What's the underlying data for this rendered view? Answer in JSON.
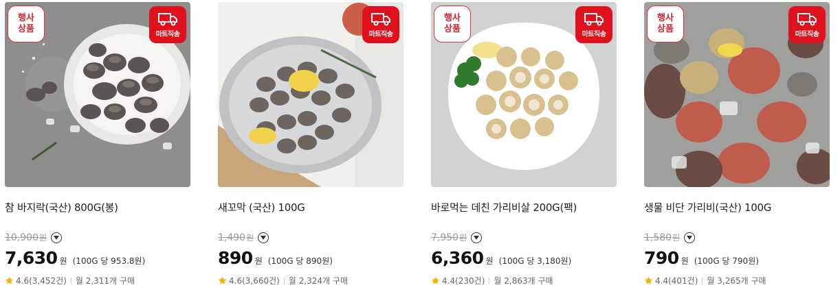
{
  "products": [
    {
      "name": "참 바지락(국산) 800G(봉)",
      "event_badge": [
        "행사",
        "상품"
      ],
      "shipping_badge": "마트직송",
      "original_price": "10,900",
      "original_unit": "원",
      "price": "7,630",
      "price_unit": "원",
      "unit_price": "(100G 당 953.8원)",
      "rating": "4.6(3,452건)",
      "monthly_sales": "월 2,311개 구매"
    },
    {
      "name": "새꼬막 (국산) 100G",
      "event_badge": null,
      "shipping_badge": "마트직송",
      "original_price": "1,490",
      "original_unit": "원",
      "price": "890",
      "price_unit": "원",
      "unit_price": "(100G 당 890원)",
      "rating": "4.6(3,660건)",
      "monthly_sales": "월 2,324개 구매"
    },
    {
      "name": "바로먹는 데친 가리비살 200G(팩)",
      "event_badge": [
        "행사",
        "상품"
      ],
      "shipping_badge": "마트직송",
      "original_price": "7,950",
      "original_unit": "원",
      "price": "6,360",
      "price_unit": "원",
      "unit_price": "(100G 당 3,180원)",
      "rating": "4.4(230건)",
      "monthly_sales": "월 2,863개 구매"
    },
    {
      "name": "생물 비단 가리비(국산) 100G",
      "event_badge": [
        "행사",
        "상품"
      ],
      "shipping_badge": "마트직송",
      "original_price": "1,580",
      "original_unit": "원",
      "price": "790",
      "price_unit": "원",
      "unit_price": "(100G 당 790원)",
      "rating": "4.4(401건)",
      "monthly_sales": "월 3,265개 구매"
    }
  ],
  "icons": {
    "truck": "truck-icon",
    "dropdown": "chevron-down-icon",
    "star": "star-icon"
  },
  "colors": {
    "badge_red": "#e0111c",
    "star": "#f5b301",
    "strike_gray": "#999999"
  }
}
